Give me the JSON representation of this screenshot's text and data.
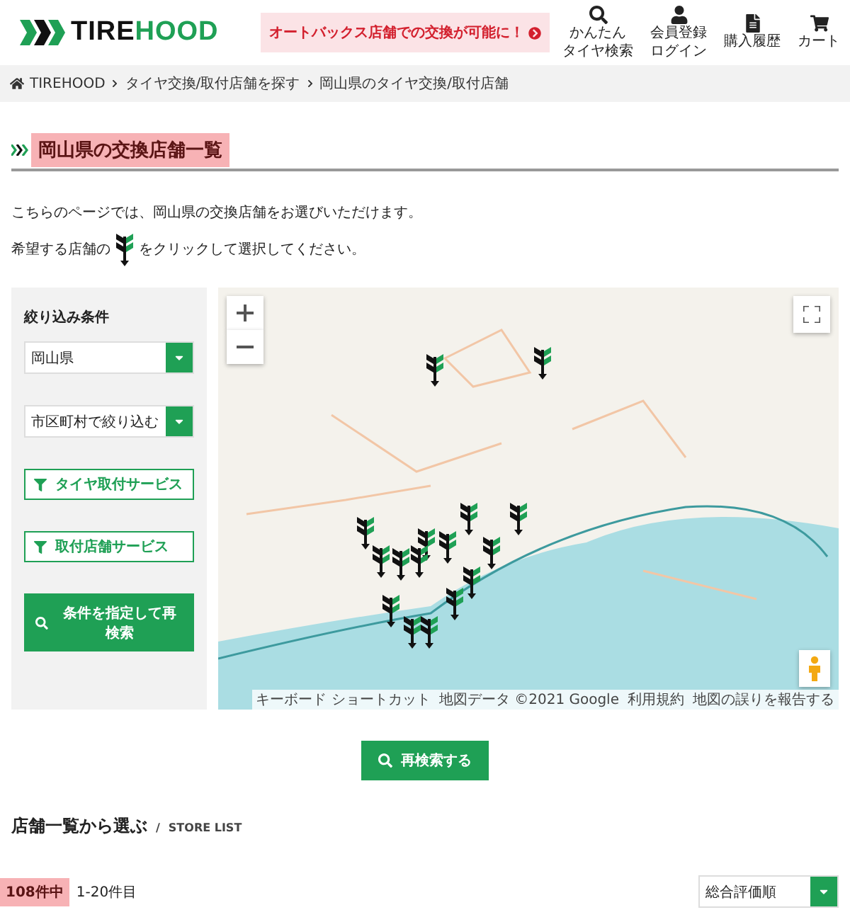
{
  "header": {
    "logo": {
      "dark": "TIRE",
      "green": "HOOD"
    },
    "banner": "オートバックス店舗での交換が可能に！",
    "nav": [
      {
        "kind": "search",
        "lines": [
          "かんたん",
          "タイヤ検索"
        ]
      },
      {
        "kind": "user",
        "lines": [
          "会員登録",
          "ログイン"
        ]
      },
      {
        "kind": "history",
        "lines": [
          "購入履歴"
        ]
      },
      {
        "kind": "cart",
        "lines": [
          "カート"
        ]
      }
    ]
  },
  "breadcrumbs": [
    "TIREHOOD",
    "タイヤ交換/取付店舗を探す",
    "岡山県のタイヤ交換/取付店舗"
  ],
  "page_title": "岡山県の交換店舗一覧",
  "intro": "こちらのページでは、岡山県の交換店舗をお選びいただけます。",
  "instruction": {
    "before": "希望する店舗の",
    "after": "をクリックして選択してください。"
  },
  "filters": {
    "title": "絞り込み条件",
    "selects": [
      {
        "value": "岡山県"
      },
      {
        "value": "市区町村で絞り込む"
      }
    ],
    "service_buttons": [
      "タイヤ取付サービス",
      "取付店舗サービス"
    ],
    "search_button": "条件を指定して再検索"
  },
  "map": {
    "attribution": [
      "キーボード ショートカット",
      "地図データ ©2021 Google",
      "利用規約",
      "地図の誤りを報告する"
    ]
  },
  "research_button": "再検索する",
  "store_list": {
    "title": "店舗一覧から選ぶ",
    "separator": "/",
    "subtitle": "STORE LIST",
    "total": "108件中",
    "range": "1-20件目",
    "sort": "総合評価順"
  }
}
